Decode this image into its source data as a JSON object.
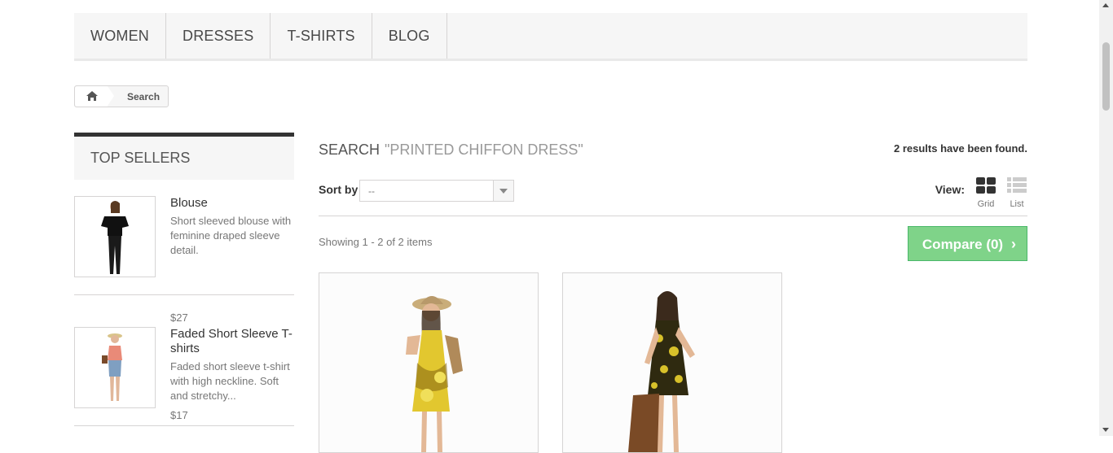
{
  "nav": {
    "items": [
      "WOMEN",
      "DRESSES",
      "T-SHIRTS",
      "BLOG"
    ]
  },
  "breadcrumb": {
    "home_icon": "home-icon",
    "current": "Search"
  },
  "sidebar": {
    "title": "TOP SELLERS",
    "items": [
      {
        "name": "Blouse",
        "desc": "Short sleeved blouse with feminine draped sleeve detail.",
        "price": "$27"
      },
      {
        "name": "Faded Short Sleeve T-shirts",
        "desc": "Faded short sleeve t-shirt with high neckline. Soft and stretchy...",
        "price": "$17"
      }
    ]
  },
  "main": {
    "heading": "SEARCH",
    "query": "\"PRINTED CHIFFON DRESS\"",
    "results": "2 results have been found.",
    "sort_label": "Sort by",
    "sort_value": "--",
    "view_label": "View:",
    "view_grid": "Grid",
    "view_list": "List",
    "showing": "Showing 1 - 2 of 2 items",
    "compare": "Compare (0)",
    "compare_chevron": "›"
  },
  "colors": {
    "compare_bg": "#7fd389",
    "compare_border": "#4ab86a",
    "dress_yellow": "#e2c72f"
  }
}
